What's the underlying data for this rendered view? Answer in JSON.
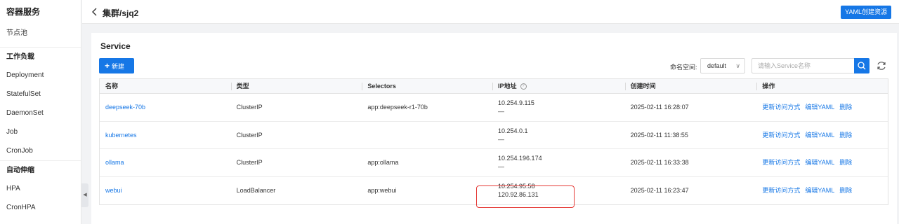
{
  "sidebar": {
    "title": "容器服务",
    "items": [
      {
        "type": "item",
        "label": "节点池"
      },
      {
        "type": "group",
        "label": "工作负载"
      },
      {
        "type": "item",
        "label": "Deployment"
      },
      {
        "type": "item",
        "label": "StatefulSet"
      },
      {
        "type": "item",
        "label": "DaemonSet"
      },
      {
        "type": "item",
        "label": "Job"
      },
      {
        "type": "item",
        "label": "CronJob"
      },
      {
        "type": "group",
        "label": "自动伸缩"
      },
      {
        "type": "item",
        "label": "HPA"
      },
      {
        "type": "item",
        "label": "CronHPA"
      }
    ],
    "collapse_glyph": "◀"
  },
  "header": {
    "breadcrumb": "集群/sjq2",
    "yaml_button": "YAML创建资源"
  },
  "main": {
    "title": "Service",
    "new_button": "新建",
    "namespace_label": "命名空间:",
    "namespace_value": "default",
    "search_placeholder": "请输入Service名称"
  },
  "table": {
    "columns": [
      "名称",
      "类型",
      "Selectors",
      "IP地址",
      "创建时间",
      "操作"
    ],
    "rows": [
      {
        "name": "deepseek-70b",
        "type": "ClusterIP",
        "selector": "app:deepseek-r1-70b",
        "ip1": "10.254.9.115",
        "ip2": "—",
        "created": "2025-02-11 16:28:07"
      },
      {
        "name": "kubernetes",
        "type": "ClusterIP",
        "selector": "",
        "ip1": "10.254.0.1",
        "ip2": "—",
        "created": "2025-02-11 11:38:55"
      },
      {
        "name": "ollama",
        "type": "ClusterIP",
        "selector": "app:ollama",
        "ip1": "10.254.196.174",
        "ip2": "—",
        "created": "2025-02-11 16:33:38"
      },
      {
        "name": "webui",
        "type": "LoadBalancer",
        "selector": "app:webui",
        "ip1": "10.254.95.58",
        "ip2": "120.92.86.131",
        "created": "2025-02-11 16:23:47"
      }
    ],
    "actions": [
      "更新访问方式",
      "编辑YAML",
      "删除"
    ]
  },
  "colors": {
    "primary": "#1677e6",
    "highlight": "#e53935"
  }
}
